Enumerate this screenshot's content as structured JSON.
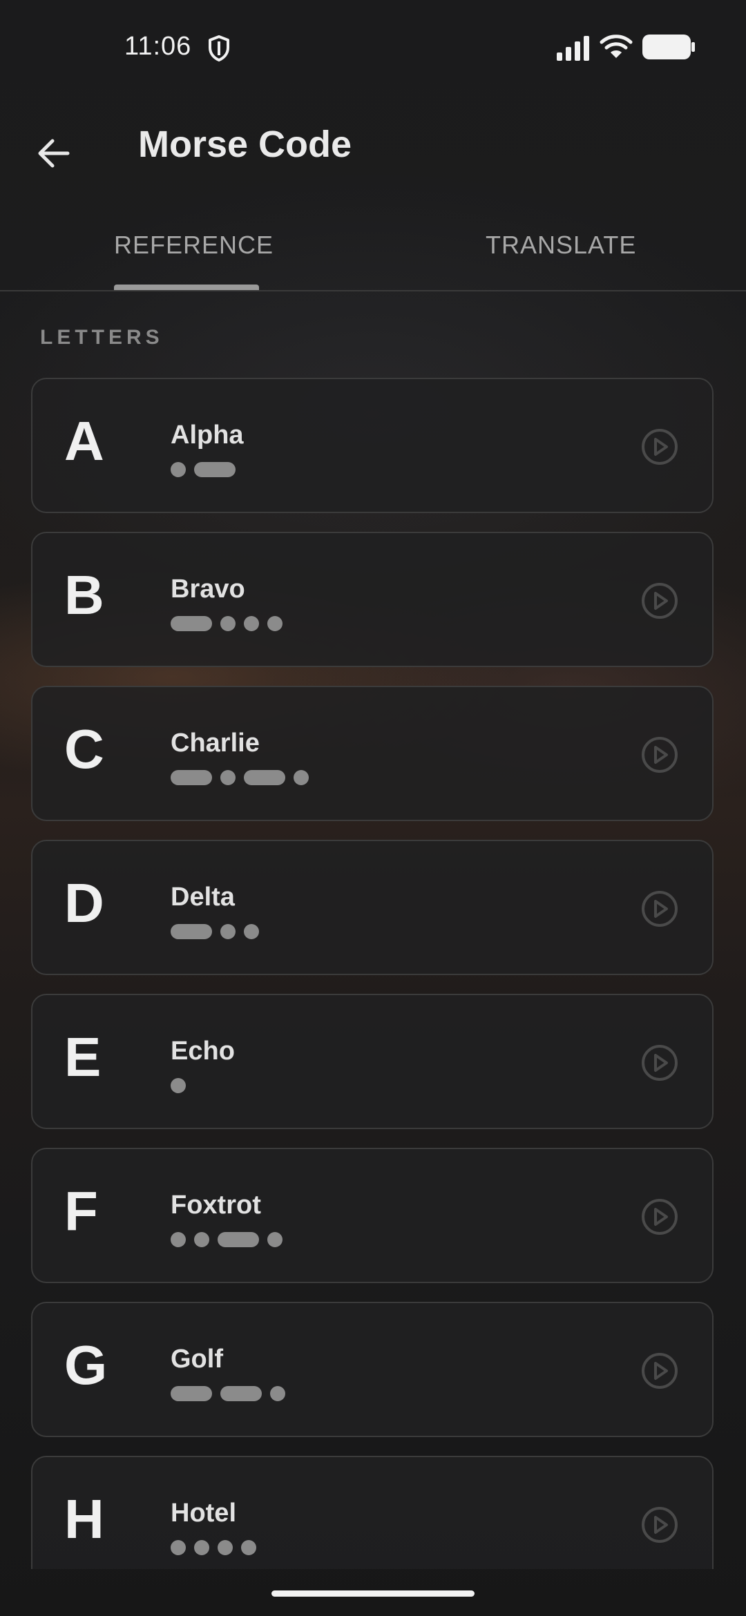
{
  "status_bar": {
    "time": "11:06"
  },
  "app_bar": {
    "title": "Morse Code"
  },
  "tabs": [
    {
      "label": "REFERENCE",
      "selected": true
    },
    {
      "label": "TRANSLATE",
      "selected": false
    }
  ],
  "section": {
    "label": "LETTERS"
  },
  "letters": [
    {
      "letter": "A",
      "name": "Alpha",
      "code": ".-"
    },
    {
      "letter": "B",
      "name": "Bravo",
      "code": "-..."
    },
    {
      "letter": "C",
      "name": "Charlie",
      "code": "-.-."
    },
    {
      "letter": "D",
      "name": "Delta",
      "code": "-.."
    },
    {
      "letter": "E",
      "name": "Echo",
      "code": "."
    },
    {
      "letter": "F",
      "name": "Foxtrot",
      "code": "..-."
    },
    {
      "letter": "G",
      "name": "Golf",
      "code": "--."
    },
    {
      "letter": "H",
      "name": "Hotel",
      "code": "...."
    }
  ],
  "icons": {
    "back": "arrow-left-icon",
    "play": "play-circle-icon",
    "shield": "shield-icon",
    "signal": "signal-icon",
    "wifi": "wifi-icon",
    "battery": "battery-icon"
  }
}
